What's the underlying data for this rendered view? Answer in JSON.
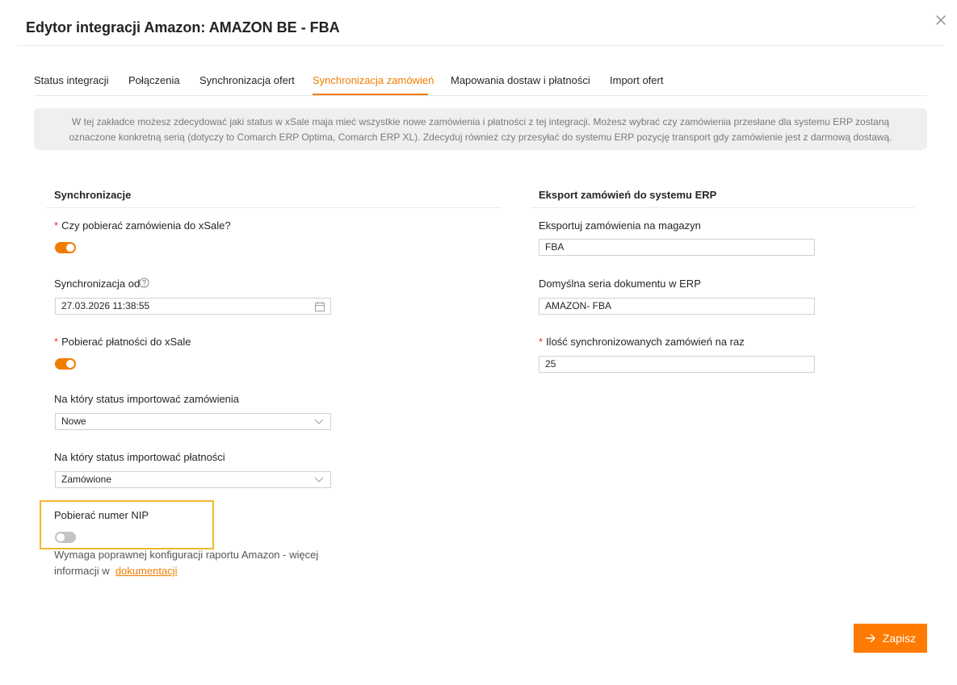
{
  "modal": {
    "title": "Edytor integracji Amazon: AMAZON BE - FBA"
  },
  "tabs": [
    {
      "label": "Status integracji"
    },
    {
      "label": "Połączenia"
    },
    {
      "label": "Synchronizacja ofert"
    },
    {
      "label": "Synchronizacja zamówień"
    },
    {
      "label": "Mapowania dostaw i płatności"
    },
    {
      "label": "Import ofert"
    }
  ],
  "active_tab": "Synchronizacja zamówień",
  "info": {
    "line1": "W tej zakładce możesz zdecydować jaki status w xSale maja mieć wszystkie nowe zamówienia i płatności z tej integracji. Możesz wybrać czy zamówienia przesłane dla systemu ERP zostaną",
    "line2": "oznaczone konkretną serią (dotyczy to Comarch ERP Optima, Comarch ERP XL). Zdecyduj również czy przesyłać do systemu ERP pozycję transport gdy zamówienie jest z darmową dostawą."
  },
  "sync": {
    "title": "Synchronizacje",
    "download_orders": {
      "label": "Czy pobierać zamówienia do xSale?",
      "enabled": true
    },
    "sync_from": {
      "label": "Synchronizacja od",
      "value": "27.03.2026 11:38:55"
    },
    "download_payments": {
      "label": "Pobierać płatności do xSale",
      "enabled": true
    },
    "order_status": {
      "label": "Na który status importować zamówienia",
      "value": "Nowe"
    },
    "payment_status": {
      "label": "Na który status importować płatności",
      "value": "Zamówione"
    },
    "nip": {
      "label": "Pobierać numer NIP",
      "enabled": false,
      "help_line1": "Wymaga poprawnej konfiguracji raportu Amazon - więcej",
      "help_line2": "informacji w",
      "help_link": "dokumentacji"
    }
  },
  "erp": {
    "title": "Eksport zamówień do systemu ERP",
    "warehouse": {
      "label": "Eksportuj zamówienia na magazyn",
      "value": "FBA"
    },
    "series": {
      "label": "Domyślna seria dokumentu w ERP",
      "value": "AMAZON- FBA"
    },
    "batch": {
      "label": "Ilość synchronizowanych zamówień na raz",
      "value": "25"
    }
  },
  "actions": {
    "save_label": "Zapisz"
  },
  "colors": {
    "accent": "#f07d00",
    "highlight": "#f2b731",
    "required": "#e5322d"
  }
}
